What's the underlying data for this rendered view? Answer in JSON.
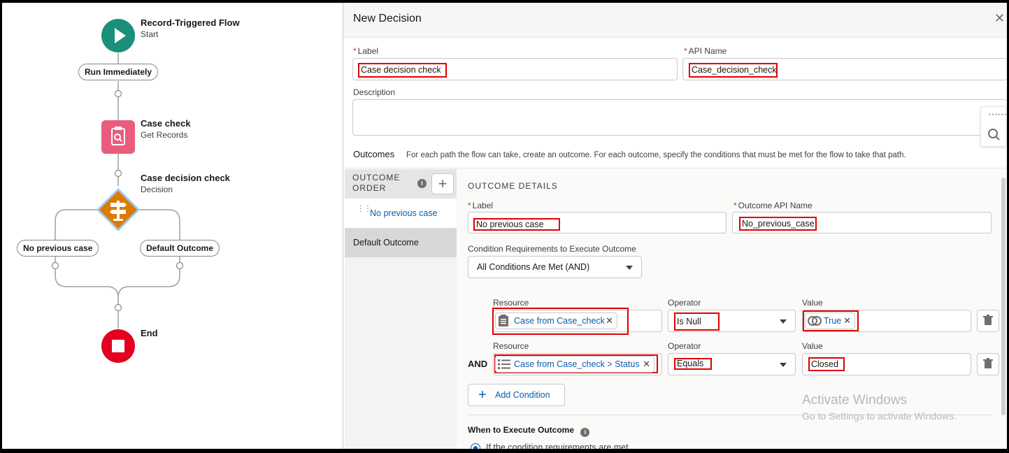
{
  "canvas": {
    "start": {
      "title": "Record-Triggered Flow",
      "subtitle": "Start"
    },
    "run_immediately": "Run Immediately",
    "get_records": {
      "title": "Case check",
      "subtitle": "Get Records"
    },
    "decision": {
      "title": "Case decision check",
      "subtitle": "Decision"
    },
    "branch_left": "No previous case",
    "branch_right": "Default Outcome",
    "end": {
      "title": "End"
    },
    "colors": {
      "start": "#1b8f7a",
      "get_records": "#ea5c7e",
      "decision": "#dd7a01",
      "end": "#e3001f"
    }
  },
  "panel": {
    "title": "New Decision",
    "label_label": "Label",
    "label_value": "Case decision check",
    "api_name_label": "API Name",
    "api_name_value": "Case_decision_check",
    "description_label": "Description",
    "outcomes_heading": "Outcomes",
    "outcomes_help": "For each path the flow can take, create an outcome. For each outcome, specify the conditions that must be met for the flow to take that path."
  },
  "outcome_order": {
    "header_line1": "OUTCOME",
    "header_line2": "ORDER",
    "items": [
      "No previous case",
      "Default Outcome"
    ]
  },
  "outcome_details": {
    "heading": "OUTCOME DETAILS",
    "label_label": "Label",
    "label_value": "No previous case",
    "api_name_label": "Outcome API Name",
    "api_name_value": "No_previous_case",
    "cond_req_label": "Condition Requirements to Execute Outcome",
    "cond_req_value": "All Conditions Are Met (AND)",
    "conditions": [
      {
        "resource_label": "Resource",
        "resource": "Case from Case_check",
        "operator_label": "Operator",
        "operator": "Is Null",
        "value_label": "Value",
        "value": "True"
      },
      {
        "resource_label": "Resource",
        "resource": "Case from Case_check > Status",
        "operator_label": "Operator",
        "operator": "Equals",
        "value_label": "Value",
        "value": "Closed"
      }
    ],
    "and_label": "AND",
    "add_condition": "Add Condition",
    "when_to_execute": "When to Execute Outcome",
    "radio_option": "If the condition requirements are met"
  },
  "watermark": {
    "line1": "Activate Windows",
    "line2": "Go to Settings to activate Windows."
  },
  "highlight_color": "#e00000"
}
